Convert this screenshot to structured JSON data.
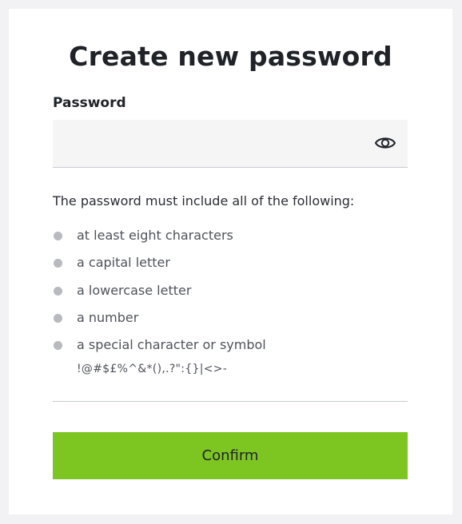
{
  "page": {
    "title": "Create new password"
  },
  "password_field": {
    "label": "Password",
    "value": "",
    "placeholder": ""
  },
  "requirements": {
    "intro": "The password must include all of the following:",
    "items": [
      {
        "label": "at least eight characters"
      },
      {
        "label": "a capital letter"
      },
      {
        "label": "a lowercase letter"
      },
      {
        "label": "a number"
      },
      {
        "label": "a special character or symbol"
      }
    ],
    "symbols": "!@#$£%^&*(),.?\":{}|<>-"
  },
  "actions": {
    "confirm_label": "Confirm"
  },
  "icons": {
    "visibility_toggle": "eye-icon",
    "requirement_status": "bullet-dot-icon"
  },
  "colors": {
    "accent": "#7dc622",
    "bullet_inactive": "#b8bac0",
    "input_background": "#f5f5f6"
  }
}
